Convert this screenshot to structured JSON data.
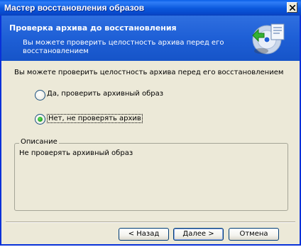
{
  "window": {
    "title": "Мастер восстановления образов",
    "close_glyph": "✕"
  },
  "header": {
    "title": "Проверка архива до восстановления",
    "description": "Вы можете проверить целостность архива перед его восстановлением",
    "icon": "restore-wizard-icon"
  },
  "main": {
    "intro": "Вы можете проверить целостность архива перед его восстановлением",
    "options": [
      {
        "label": "Да, проверить архивный образ",
        "selected": false
      },
      {
        "label": "Нет, не проверять архив",
        "selected": true
      }
    ]
  },
  "description_group": {
    "label": "Описание",
    "text": "Не проверять архивный образ"
  },
  "buttons": {
    "back": "< Назад",
    "next": "Далее >",
    "cancel": "Отмена"
  },
  "colors": {
    "title_bar": "#0a58dc",
    "header_bg": "#1e5fd6",
    "dialog_bg": "#ece9d8",
    "radio_selected": "#21a121"
  }
}
